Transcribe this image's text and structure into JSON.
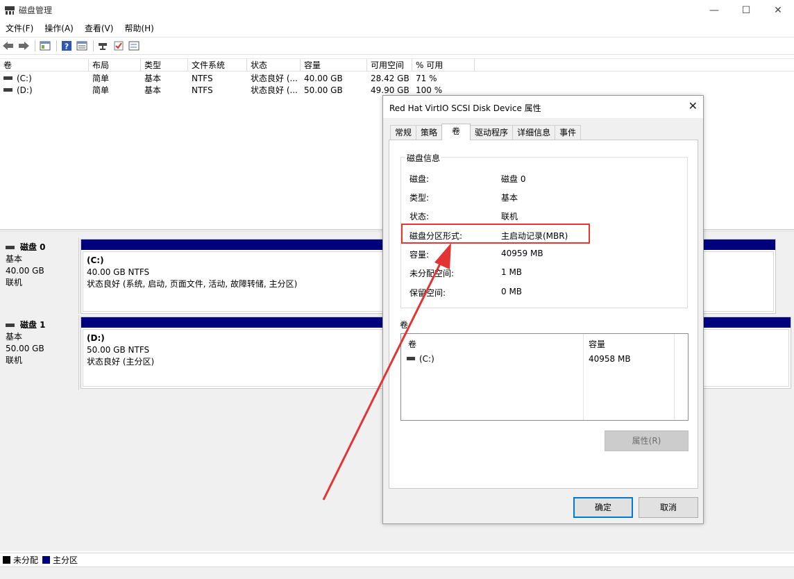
{
  "window": {
    "title": "磁盘管理",
    "minimize_glyph": "—",
    "maximize_glyph": "☐",
    "close_glyph": "✕"
  },
  "menu": [
    "文件(F)",
    "操作(A)",
    "查看(V)",
    "帮助(H)"
  ],
  "toolbar_icons": [
    "back-icon",
    "forward-icon",
    "console-tree-icon",
    "help-icon",
    "properties-icon",
    "connect-icon",
    "check-icon",
    "settings-icon"
  ],
  "volume_list": {
    "columns": [
      "卷",
      "布局",
      "类型",
      "文件系统",
      "状态",
      "容量",
      "可用空间",
      "% 可用"
    ],
    "rows": [
      [
        "(C:)",
        "简单",
        "基本",
        "NTFS",
        "状态良好 (...",
        "40.00 GB",
        "28.42 GB",
        "71 %"
      ],
      [
        "(D:)",
        "简单",
        "基本",
        "NTFS",
        "状态良好 (...",
        "50.00 GB",
        "49.90 GB",
        "100 %"
      ]
    ]
  },
  "disks": [
    {
      "name": "磁盘 0",
      "type": "基本",
      "size": "40.00 GB",
      "state": "联机",
      "partition": {
        "name": "(C:)",
        "fs": "40.00 GB NTFS",
        "status": "状态良好 (系统, 启动, 页面文件, 活动, 故障转储, 主分区)"
      }
    },
    {
      "name": "磁盘 1",
      "type": "基本",
      "size": "50.00 GB",
      "state": "联机",
      "partition": {
        "name": "(D:)",
        "fs": "50.00 GB NTFS",
        "status": "状态良好 (主分区)"
      }
    }
  ],
  "legend": [
    {
      "label": "未分配",
      "color": "#000000"
    },
    {
      "label": "主分区",
      "color": "#00007f"
    }
  ],
  "dialog": {
    "title": "Red Hat VirtIO SCSI Disk Device 属性",
    "close_glyph": "✕",
    "tabs": [
      "常规",
      "策略",
      "卷",
      "驱动程序",
      "详细信息",
      "事件"
    ],
    "active_tab": "卷",
    "group_title": "磁盘信息",
    "info": [
      {
        "key": "磁盘:",
        "value": "磁盘 0"
      },
      {
        "key": "类型:",
        "value": "基本"
      },
      {
        "key": "状态:",
        "value": "联机"
      },
      {
        "key": "磁盘分区形式:",
        "value": "主启动记录(MBR)"
      },
      {
        "key": "容量:",
        "value": "40959 MB"
      },
      {
        "key": "未分配空间:",
        "value": "1 MB"
      },
      {
        "key": "保留空间:",
        "value": "0 MB"
      }
    ],
    "volumes_label": "卷",
    "vol_table": {
      "col_volume": "卷",
      "col_capacity": "容量",
      "row_volume": "(C:)",
      "row_capacity": "40958 MB"
    },
    "properties_button": "属性(R)",
    "ok_button": "确定",
    "cancel_button": "取消"
  },
  "colors": {
    "primary_partition": "#00007f",
    "annotation_red": "#e33333",
    "focus_blue": "#0078d7"
  }
}
